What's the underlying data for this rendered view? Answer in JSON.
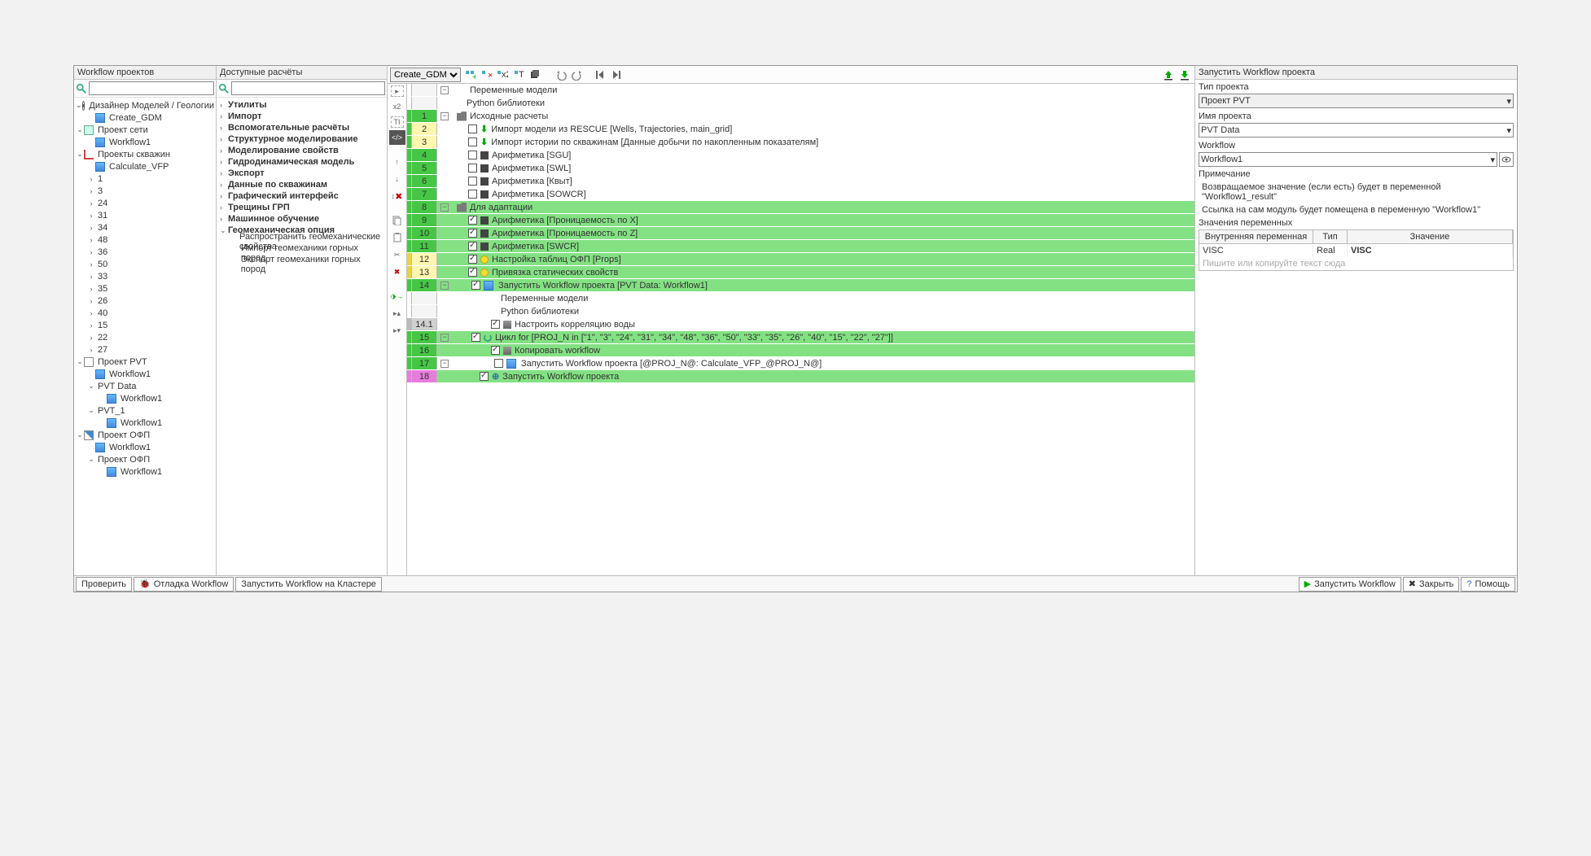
{
  "panels": {
    "left_title": "Workflow проектов",
    "calc_title": "Доступные расчёты",
    "right_title": "Запустить Workflow проекта"
  },
  "wf_select": "Create_GDM",
  "left_tree": [
    {
      "d": 0,
      "t": "v",
      "ico": "gear",
      "lbl": "Дизайнер Моделей / Геологии"
    },
    {
      "d": 1,
      "t": "",
      "ico": "wf",
      "lbl": "Create_GDM"
    },
    {
      "d": 0,
      "t": "v",
      "ico": "net",
      "lbl": "Проект сети"
    },
    {
      "d": 1,
      "t": "",
      "ico": "wf",
      "lbl": "Workflow1"
    },
    {
      "d": 0,
      "t": "v",
      "ico": "well",
      "lbl": "Проекты скважин"
    },
    {
      "d": 1,
      "t": "",
      "ico": "wf",
      "lbl": "Calculate_VFP"
    },
    {
      "d": 1,
      "t": ">",
      "ico": "",
      "lbl": "1"
    },
    {
      "d": 1,
      "t": ">",
      "ico": "",
      "lbl": "3"
    },
    {
      "d": 1,
      "t": ">",
      "ico": "",
      "lbl": "24"
    },
    {
      "d": 1,
      "t": ">",
      "ico": "",
      "lbl": "31"
    },
    {
      "d": 1,
      "t": ">",
      "ico": "",
      "lbl": "34"
    },
    {
      "d": 1,
      "t": ">",
      "ico": "",
      "lbl": "48"
    },
    {
      "d": 1,
      "t": ">",
      "ico": "",
      "lbl": "36"
    },
    {
      "d": 1,
      "t": ">",
      "ico": "",
      "lbl": "50"
    },
    {
      "d": 1,
      "t": ">",
      "ico": "",
      "lbl": "33"
    },
    {
      "d": 1,
      "t": ">",
      "ico": "",
      "lbl": "35"
    },
    {
      "d": 1,
      "t": ">",
      "ico": "",
      "lbl": "26"
    },
    {
      "d": 1,
      "t": ">",
      "ico": "",
      "lbl": "40"
    },
    {
      "d": 1,
      "t": ">",
      "ico": "",
      "lbl": "15"
    },
    {
      "d": 1,
      "t": ">",
      "ico": "",
      "lbl": "22"
    },
    {
      "d": 1,
      "t": ">",
      "ico": "",
      "lbl": "27"
    },
    {
      "d": 0,
      "t": "v",
      "ico": "pvt",
      "lbl": "Проект PVT"
    },
    {
      "d": 1,
      "t": "",
      "ico": "wf",
      "lbl": "Workflow1"
    },
    {
      "d": 1,
      "t": "v",
      "ico": "",
      "lbl": "PVT Data"
    },
    {
      "d": 2,
      "t": "",
      "ico": "wf",
      "lbl": "Workflow1"
    },
    {
      "d": 1,
      "t": "v",
      "ico": "",
      "lbl": "PVT_1"
    },
    {
      "d": 2,
      "t": "",
      "ico": "wf",
      "lbl": "Workflow1"
    },
    {
      "d": 0,
      "t": "v",
      "ico": "ofp",
      "lbl": "Проект ОФП"
    },
    {
      "d": 1,
      "t": "",
      "ico": "wf",
      "lbl": "Workflow1"
    },
    {
      "d": 1,
      "t": "v",
      "ico": "",
      "lbl": "Проект ОФП"
    },
    {
      "d": 2,
      "t": "",
      "ico": "wf",
      "lbl": "Workflow1"
    }
  ],
  "calc_list": [
    {
      "t": ">",
      "b": 1,
      "lbl": "Утилиты"
    },
    {
      "t": ">",
      "b": 1,
      "lbl": "Импорт"
    },
    {
      "t": ">",
      "b": 1,
      "lbl": "Вспомогательные расчёты"
    },
    {
      "t": ">",
      "b": 1,
      "lbl": "Структурное моделирование"
    },
    {
      "t": ">",
      "b": 1,
      "lbl": "Моделирование свойств"
    },
    {
      "t": ">",
      "b": 1,
      "lbl": "Гидродинамическая модель"
    },
    {
      "t": ">",
      "b": 1,
      "lbl": "Экспорт"
    },
    {
      "t": ">",
      "b": 1,
      "lbl": "Данные по скважинам"
    },
    {
      "t": ">",
      "b": 1,
      "lbl": "Графический интерфейс"
    },
    {
      "t": ">",
      "b": 1,
      "lbl": "Трещины ГРП"
    },
    {
      "t": ">",
      "b": 1,
      "lbl": "Машинное обучение"
    },
    {
      "t": "v",
      "b": 1,
      "lbl": "Геомеханическая опция"
    },
    {
      "t": "",
      "b": 0,
      "lbl": "Распространить геомеханические свойства",
      "child": 1
    },
    {
      "t": "",
      "b": 0,
      "lbl": "Импорт геомеханики горных пород",
      "child": 1
    },
    {
      "t": "",
      "b": 0,
      "lbl": "Экспорт геомеханики горных пород",
      "child": 1
    }
  ],
  "side_labels": {
    "x2": "x2",
    "ti": "TI"
  },
  "wf_rows": [
    {
      "bar": "",
      "num": "",
      "ncls": "",
      "bg": "",
      "sq": 1,
      "ind": 16,
      "chk": -1,
      "ico": "",
      "lbl": "Переменные модели"
    },
    {
      "bar": "",
      "num": "",
      "ncls": "",
      "bg": "",
      "sq": 0,
      "ind": 30,
      "chk": -1,
      "ico": "",
      "lbl": "Python библиотеки"
    },
    {
      "bar": "g",
      "num": "1",
      "ncls": "green",
      "bg": "",
      "sq": 1,
      "ind": 0,
      "chk": -1,
      "ico": "folder",
      "lbl": "Исходные расчеты"
    },
    {
      "bar": "g",
      "num": "2",
      "ncls": "yellow",
      "bg": "",
      "sq": 0,
      "ind": 32,
      "chk": 0,
      "ico": "dl",
      "lbl": "Импорт модели из RESCUE [Wells, Trajectories, main_grid]"
    },
    {
      "bar": "g",
      "num": "3",
      "ncls": "yellow",
      "bg": "",
      "sq": 0,
      "ind": 32,
      "chk": 0,
      "ico": "dl",
      "lbl": "Импорт истории по скважинам [Данные добычи по накопленным показателям]"
    },
    {
      "bar": "g",
      "num": "4",
      "ncls": "green",
      "bg": "",
      "sq": 0,
      "ind": 32,
      "chk": 0,
      "ico": "calc",
      "lbl": "Арифметика [SGU]"
    },
    {
      "bar": "g",
      "num": "5",
      "ncls": "green",
      "bg": "",
      "sq": 0,
      "ind": 32,
      "chk": 0,
      "ico": "calc",
      "lbl": "Арифметика [SWL]"
    },
    {
      "bar": "g",
      "num": "6",
      "ncls": "green",
      "bg": "",
      "sq": 0,
      "ind": 32,
      "chk": 0,
      "ico": "calc",
      "lbl": "Арифметика [Квыт]"
    },
    {
      "bar": "g",
      "num": "7",
      "ncls": "green",
      "bg": "",
      "sq": 0,
      "ind": 32,
      "chk": 0,
      "ico": "calc",
      "lbl": "Арифметика [SOWCR]"
    },
    {
      "bar": "g",
      "num": "8",
      "ncls": "green",
      "bg": "g",
      "sq": 1,
      "ind": 0,
      "chk": -1,
      "ico": "folder",
      "lbl": "Для адаптации"
    },
    {
      "bar": "g",
      "num": "9",
      "ncls": "green",
      "bg": "g",
      "sq": 0,
      "ind": 32,
      "chk": 1,
      "ico": "calc",
      "lbl": "Арифметика [Проницаемость по X]"
    },
    {
      "bar": "g",
      "num": "10",
      "ncls": "green",
      "bg": "g",
      "sq": 0,
      "ind": 32,
      "chk": 1,
      "ico": "calc",
      "lbl": "Арифметика [Проницаемость по Z]"
    },
    {
      "bar": "g",
      "num": "11",
      "ncls": "green",
      "bg": "g",
      "sq": 0,
      "ind": 32,
      "chk": 1,
      "ico": "calc",
      "lbl": "Арифметика [SWCR]"
    },
    {
      "bar": "y",
      "num": "12",
      "ncls": "yellow",
      "bg": "g",
      "sq": 0,
      "ind": 32,
      "chk": 1,
      "ico": "circ",
      "lbl": "Настройка таблиц ОФП [Props]"
    },
    {
      "bar": "y",
      "num": "13",
      "ncls": "yellow",
      "bg": "g",
      "sq": 0,
      "ind": 32,
      "chk": 1,
      "ico": "circ",
      "lbl": "Привязка статических свойств"
    },
    {
      "bar": "g",
      "num": "14",
      "ncls": "green",
      "bg": "g",
      "sq": 1,
      "ind": 18,
      "chk": 1,
      "ico": "wf",
      "lbl": "Запустить Workflow проекта [PVT Data: Workflow1]"
    },
    {
      "bar": "",
      "num": "",
      "ncls": "",
      "bg": "",
      "sq": 0,
      "ind": 72,
      "chk": -1,
      "ico": "",
      "lbl": "Переменные модели"
    },
    {
      "bar": "",
      "num": "",
      "ncls": "",
      "bg": "",
      "sq": 0,
      "ind": 72,
      "chk": -1,
      "ico": "",
      "lbl": "Python библиотеки"
    },
    {
      "bar": "s",
      "num": "14.1",
      "ncls": "grey",
      "bg": "",
      "sq": 0,
      "ind": 60,
      "chk": 1,
      "ico": "cfg",
      "lbl": "Настроить корреляцию воды"
    },
    {
      "bar": "g",
      "num": "15",
      "ncls": "green",
      "bg": "g",
      "sq": 1,
      "ind": 18,
      "chk": 1,
      "ico": "loop",
      "lbl": "Цикл for [PROJ_N in [\"1\", \"3\", \"24\", \"31\", \"34\", \"48\", \"36\", \"50\", \"33\", \"35\", \"26\", \"40\", \"15\", \"22\", \"27\"]]"
    },
    {
      "bar": "g",
      "num": "16",
      "ncls": "green",
      "bg": "g",
      "sq": 0,
      "ind": 60,
      "chk": 1,
      "ico": "cfg",
      "lbl": "Копировать workflow"
    },
    {
      "bar": "g",
      "num": "17",
      "ncls": "green",
      "bg": "",
      "sq": 1,
      "ind": 46,
      "chk": 0,
      "ico": "wf",
      "lbl": "Запустить Workflow проекта [@PROJ_N@: Calculate_VFP_@PROJ_N@]"
    },
    {
      "bar": "p",
      "num": "18",
      "ncls": "pink",
      "bg": "g",
      "sq": 0,
      "ind": 46,
      "chk": 1,
      "ico": "py",
      "lbl": "Запустить Workflow проекта"
    }
  ],
  "right": {
    "type_lbl": "Тип проекта",
    "type_val": "Проект PVT",
    "name_lbl": "Имя проекта",
    "name_val": "PVT Data",
    "wf_lbl": "Workflow",
    "wf_val": "Workflow1",
    "note_lbl": "Примечание",
    "note1": "Возвращаемое значение (если есть) будет в переменной \"Workflow1_result\"",
    "note2": "Ссылка на сам модуль будет помещена в переменную \"Workflow1\"",
    "vars_lbl": "Значения переменных",
    "col1": "Внутренняя переменная",
    "col2": "Тип",
    "col3": "Значение",
    "var_name": "VISC",
    "var_type": "Real",
    "var_val": "VISC",
    "placeholder": "Пишите или копируйте текст сюда"
  },
  "footer": {
    "check": "Проверить",
    "debug": "Отладка Workflow",
    "cluster": "Запустить Workflow на Кластере",
    "run": "Запустить Workflow",
    "close": "Закрыть",
    "help": "Помощь"
  }
}
